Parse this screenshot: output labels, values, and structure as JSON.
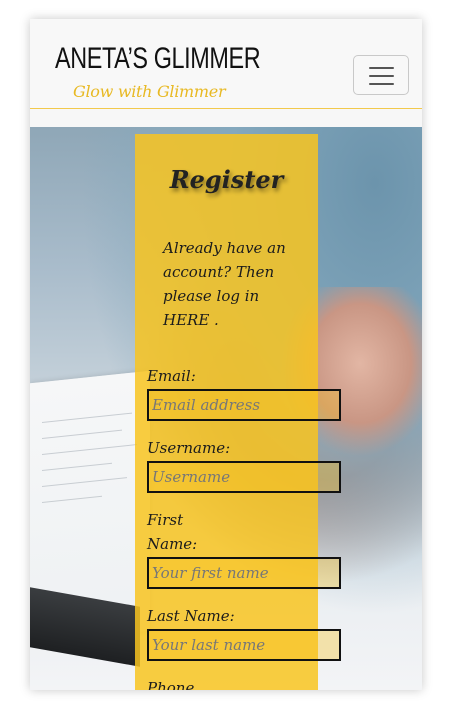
{
  "navbar": {
    "brand_title": "ANETA’S GLIMMER",
    "brand_tagline": "Glow with Glimmer",
    "menu_icon": "hamburger-menu-icon"
  },
  "register": {
    "title": "Register",
    "intro_text": "Already have an account? Then please log in",
    "login_link": "HERE",
    "intro_suffix": " .",
    "fields": {
      "email": {
        "label": "Email:",
        "placeholder": "Email address"
      },
      "username": {
        "label": "Username:",
        "placeholder": "Username"
      },
      "first_name": {
        "label_line1": "First",
        "label_line2": "Name:",
        "placeholder": "Your first name"
      },
      "last_name": {
        "label": "Last Name:",
        "placeholder": "Your last name"
      },
      "phone": {
        "label": "Phone"
      }
    }
  },
  "colors": {
    "accent": "#f8c420",
    "tagline": "#e8b923",
    "navbar_bg": "#f8f8f8"
  }
}
